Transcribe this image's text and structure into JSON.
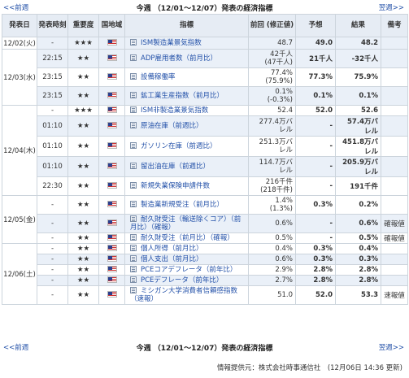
{
  "nav": {
    "prev": "<<前週",
    "next": "翌週>>",
    "title": "今週 （12/01～12/07）発表の経済指標"
  },
  "headers": {
    "date": "発表日",
    "time": "発表時刻",
    "importance": "重要度",
    "country": "国地域",
    "indicator": "指標",
    "previous": "前回 (修正値)",
    "forecast": "予想",
    "result": "結果",
    "note": "備考"
  },
  "rows": [
    {
      "date": "12/02(火)",
      "time": "-",
      "importance": "★★★",
      "country": "us-flag",
      "indicator": "ISM製造業景気指数",
      "prev": "48.7",
      "prev2": "",
      "forecast": "49.0",
      "result": "48.2",
      "note": ""
    },
    {
      "date": "12/03(水)",
      "time": "22:15",
      "importance": "★★",
      "country": "us-flag",
      "indicator": "ADP雇用者数（前月比）",
      "prev": "42千人",
      "prev2": "(47千人)",
      "forecast": "21千人",
      "result": "-32千人",
      "note": ""
    },
    {
      "date": "",
      "time": "23:15",
      "importance": "★★",
      "country": "us-flag",
      "indicator": "設備稼働率",
      "prev": "77.4%",
      "prev2": "(75.9%)",
      "forecast": "77.3%",
      "result": "75.9%",
      "note": ""
    },
    {
      "date": "",
      "time": "23:15",
      "importance": "★★",
      "country": "us-flag",
      "indicator": "鉱工業生産指数（前月比）",
      "prev": "0.1%",
      "prev2": "(-0.3%)",
      "forecast": "0.1%",
      "result": "0.1%",
      "note": ""
    },
    {
      "date": "12/04(木)",
      "time": "-",
      "importance": "★★★",
      "country": "us-flag",
      "indicator": "ISM非製造業景気指数",
      "prev": "52.4",
      "prev2": "",
      "forecast": "52.0",
      "result": "52.6",
      "note": ""
    },
    {
      "date": "",
      "time": "01:10",
      "importance": "★★",
      "country": "us-flag",
      "indicator": "原油在庫（前週比）",
      "prev": "277.4万バ",
      "prev2": "レル",
      "forecast": "-",
      "result": "57.4万バ",
      "result2": "レル",
      "note": ""
    },
    {
      "date": "",
      "time": "01:10",
      "importance": "★★",
      "country": "us-flag",
      "indicator": "ガソリン在庫（前週比）",
      "prev": "251.3万バ",
      "prev2": "レル",
      "forecast": "-",
      "result": "451.8万バ",
      "result2": "レル",
      "note": ""
    },
    {
      "date": "",
      "time": "01:10",
      "importance": "★★",
      "country": "us-flag",
      "indicator": "留出油在庫（前週比）",
      "prev": "114.7万バ",
      "prev2": "レル",
      "forecast": "-",
      "result": "205.9万バ",
      "result2": "レル",
      "note": ""
    },
    {
      "date": "",
      "time": "22:30",
      "importance": "★★",
      "country": "us-flag",
      "indicator": "新規失業保険申請件数",
      "prev": "216千件",
      "prev2": "(218千件)",
      "forecast": "-",
      "result": "191千件",
      "note": ""
    },
    {
      "date": "12/05(金)",
      "time": "-",
      "importance": "★★",
      "country": "us-flag",
      "indicator": "製造業新規受注（前月比）",
      "prev": "1.4%",
      "prev2": "(1.3%)",
      "forecast": "0.3%",
      "result": "0.2%",
      "note": ""
    },
    {
      "date": "",
      "time": "-",
      "importance": "★★",
      "country": "us-flag",
      "indicator": "耐久財受注（輸送除くコア）（前月比）（確報）",
      "prev": "0.6%",
      "prev2": "",
      "forecast": "-",
      "result": "0.6%",
      "note": "確報値"
    },
    {
      "date": "",
      "time": "-",
      "importance": "★★",
      "country": "us-flag",
      "indicator": "耐久財受注（前月比）（確報）",
      "prev": "0.5%",
      "prev2": "",
      "forecast": "-",
      "result": "0.5%",
      "note": "確報値"
    },
    {
      "date": "12/06(土)",
      "time": "-",
      "importance": "★★",
      "country": "us-flag",
      "indicator": "個人所得（前月比）",
      "prev": "0.4%",
      "prev2": "",
      "forecast": "0.3%",
      "result": "0.4%",
      "note": ""
    },
    {
      "date": "",
      "time": "-",
      "importance": "★★",
      "country": "us-flag",
      "indicator": "個人支出（前月比）",
      "prev": "0.6%",
      "prev2": "",
      "forecast": "0.3%",
      "result": "0.3%",
      "note": ""
    },
    {
      "date": "",
      "time": "-",
      "importance": "★★",
      "country": "us-flag",
      "indicator": "PCEコアデフレータ（前年比）",
      "prev": "2.9%",
      "prev2": "",
      "forecast": "2.8%",
      "result": "2.8%",
      "note": ""
    },
    {
      "date": "",
      "time": "-",
      "importance": "★★",
      "country": "us-flag",
      "indicator": "PCEデフレータ（前年比）",
      "prev": "2.7%",
      "prev2": "",
      "forecast": "2.8%",
      "result": "2.8%",
      "note": ""
    },
    {
      "date": "",
      "time": "-",
      "importance": "★★",
      "country": "us-flag",
      "indicator": "ミシガン大学消費者信頼感指数（速報）",
      "prev": "51.0",
      "prev2": "",
      "forecast": "52.0",
      "result": "53.3",
      "note": "速報値"
    }
  ],
  "source": "情報提供元：株式会社時事通信社　(12月06日 14:36 更新)",
  "colors": {
    "link": "#2250a8",
    "header_bg": "#e6ecf4",
    "row_shade": "#eaf0f8",
    "border": "#ccd4dc"
  }
}
